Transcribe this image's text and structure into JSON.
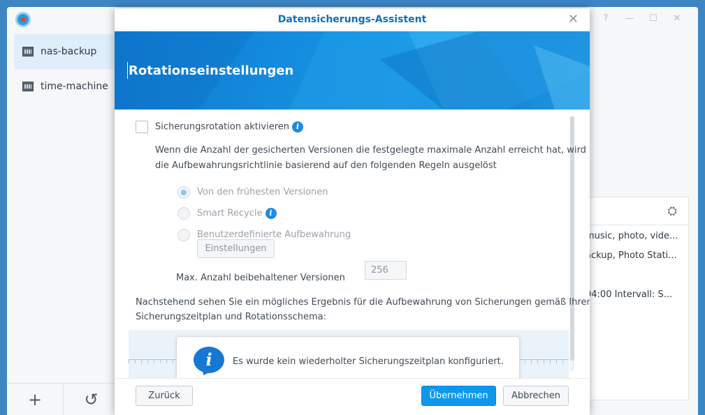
{
  "app": {
    "sidebar": {
      "items": [
        {
          "label": "nas-backup",
          "active": true
        },
        {
          "label": "time-machine",
          "active": false
        }
      ],
      "footer": {
        "add_icon": "+",
        "history_icon": "↺"
      }
    },
    "window_controls": [
      "?",
      "—",
      "☐",
      "✕"
    ],
    "main_lines": [
      "music, photo, vide...",
      "ackup, Photo Stati...",
      "04:00 Intervall: S..."
    ]
  },
  "dialog": {
    "title": "Datensicherungs-Assistent",
    "close_icon": "✕",
    "banner_title": "Rotationseinstellungen",
    "rotation_checkbox_label": "Sicherungsrotation aktivieren",
    "rotation_checked": false,
    "description_line1": "Wenn die Anzahl der gesicherten Versionen die festgelegte maximale Anzahl erreicht hat, wird",
    "description_line2": "die Aufbewahrungsrichtlinie basierend auf den folgenden Regeln ausgelöst",
    "options": [
      {
        "label": "Von den frühesten Versionen",
        "checked": true,
        "info": false
      },
      {
        "label": "Smart Recycle",
        "checked": false,
        "info": true
      },
      {
        "label": "Benutzerdefinierte Aufbewahrung",
        "checked": false,
        "info": false
      }
    ],
    "settings_button": "Einstellungen",
    "max_versions_label": "Max. Anzahl beibehaltener Versionen",
    "max_versions_value": "256",
    "result_line1": "Nachstehend sehen Sie ein mögliches Ergebnis für die Aufbewahrung von Sicherungen gemäß Ihrem",
    "result_line2": "Sicherungszeitplan und Rotationsschema:",
    "notice_text": "Es wurde kein wiederholter Sicherungszeitplan konfiguriert.",
    "buttons": {
      "back": "Zurück",
      "apply": "Übernehmen",
      "cancel": "Abbrechen"
    }
  },
  "colors": {
    "accent": "#0e98ec",
    "title_blue": "#0e6fb8",
    "banner_blue": "#1590e0"
  }
}
